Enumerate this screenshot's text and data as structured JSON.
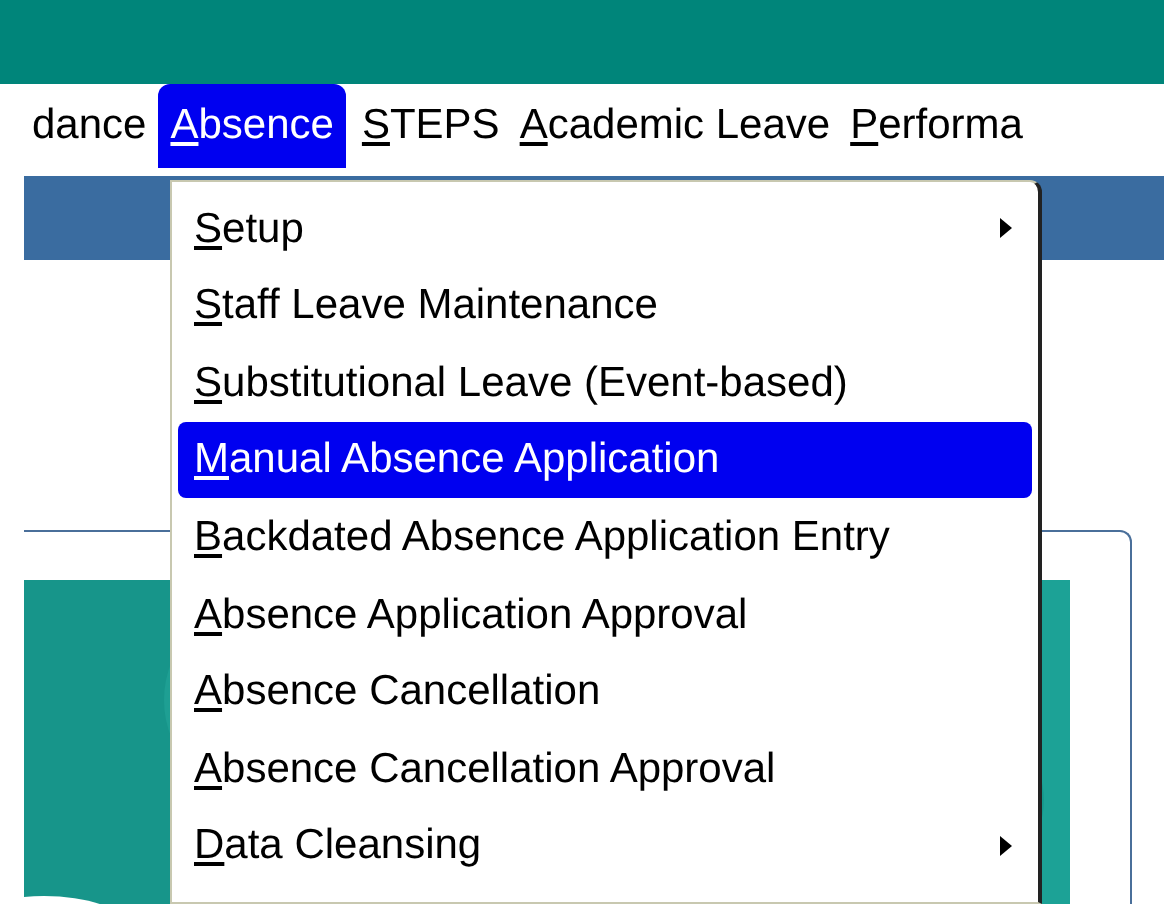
{
  "menu_bar": [
    {
      "label": "dance",
      "selected": false
    },
    {
      "label": "Absence",
      "selected": true
    },
    {
      "label": "STEPS",
      "selected": false
    },
    {
      "label": "Academic Leave",
      "selected": false
    },
    {
      "label": "Performa",
      "selected": false
    }
  ],
  "dropdown": [
    {
      "label": "Setup",
      "selected": false,
      "submenu": true
    },
    {
      "label": "Staff Leave Maintenance",
      "selected": false,
      "submenu": false
    },
    {
      "label": "Substitutional Leave (Event-based)",
      "selected": false,
      "submenu": false
    },
    {
      "label": "Manual Absence Application",
      "selected": true,
      "submenu": false
    },
    {
      "label": "Backdated Absence Application Entry",
      "selected": false,
      "submenu": false
    },
    {
      "label": "Absence Application Approval",
      "selected": false,
      "submenu": false
    },
    {
      "label": "Absence Cancellation",
      "selected": false,
      "submenu": false
    },
    {
      "label": "Absence Cancellation Approval",
      "selected": false,
      "submenu": false
    },
    {
      "label": "Data Cleansing",
      "selected": false,
      "submenu": true
    }
  ]
}
